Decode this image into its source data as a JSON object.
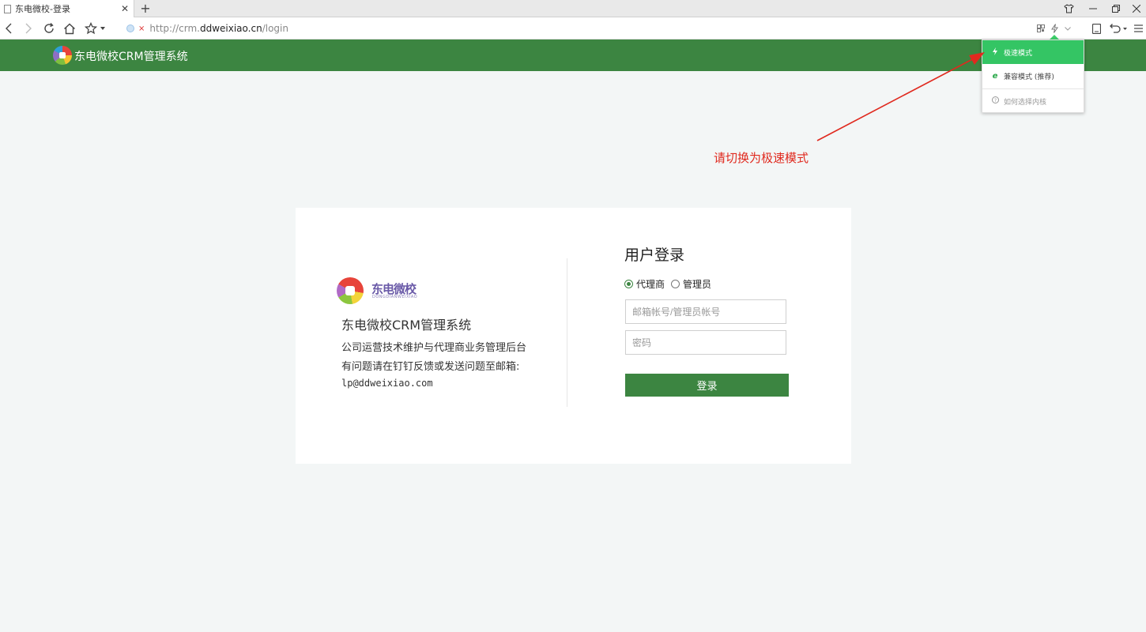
{
  "browser": {
    "tab": {
      "title": "东电微校-登录"
    },
    "address": {
      "scheme": "http://crm.",
      "domain": "ddweixiao.cn",
      "path": "/login"
    }
  },
  "site": {
    "title": "东电微校CRM管理系统"
  },
  "kernel_menu": {
    "items": [
      {
        "label": "极速模式",
        "icon": "lightning-icon",
        "active": true
      },
      {
        "label": "兼容模式 (推荐)",
        "icon": "ie-icon",
        "active": false
      },
      {
        "label": "如何选择内核",
        "icon": "help-icon",
        "active": false
      }
    ]
  },
  "annotation": {
    "text": "请切换为极速模式",
    "color": "#e02a1f"
  },
  "brand": {
    "cn": "东电微校",
    "en": "DONGDIANWEIXIAO"
  },
  "info": {
    "system_name": "东电微校CRM管理系统",
    "line1": "公司运营技术维护与代理商业务管理后台",
    "line2": "有问题请在钉钉反馈或发送问题至邮箱:",
    "email": "lp@ddweixiao.com"
  },
  "login": {
    "title": "用户登录",
    "roles": [
      {
        "label": "代理商",
        "checked": true
      },
      {
        "label": "管理员",
        "checked": false
      }
    ],
    "account_placeholder": "邮箱帐号/管理员帐号",
    "password_placeholder": "密码",
    "submit_label": "登录"
  },
  "colors": {
    "brand_green": "#3c8541",
    "menu_active": "#34c564",
    "background": "#f3f6f6"
  }
}
